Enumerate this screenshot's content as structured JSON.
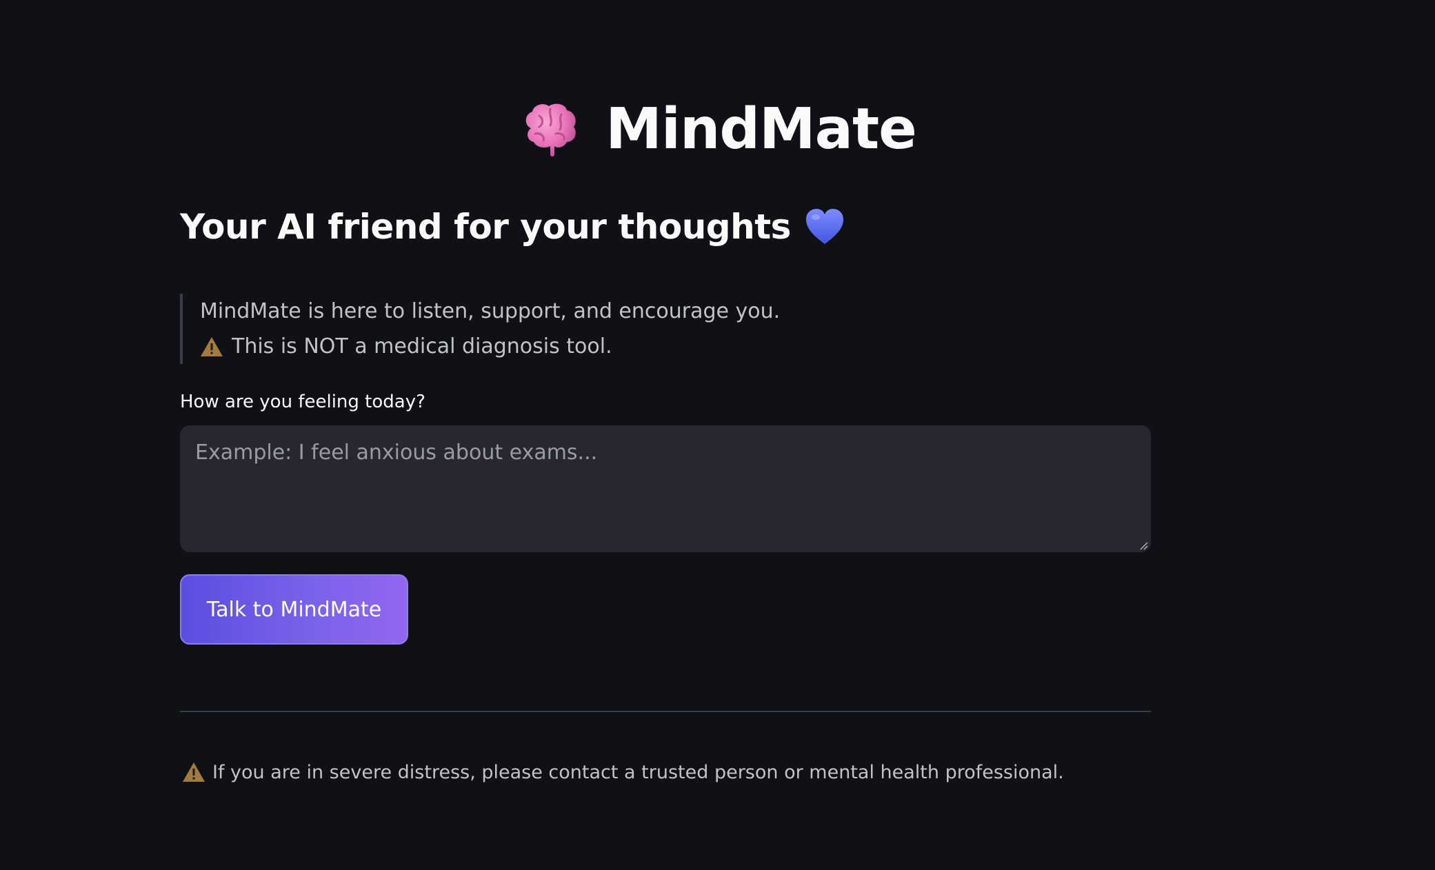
{
  "header": {
    "title": "MindMate",
    "title_icon": "brain-icon",
    "subtitle": "Your AI friend for your thoughts",
    "subtitle_icon": "blue-heart-icon"
  },
  "intro": {
    "line1": "MindMate is here to listen, support, and encourage you.",
    "line2": "This is NOT a medical diagnosis tool.",
    "line2_icon": "warning-icon"
  },
  "form": {
    "label": "How are you feeling today?",
    "placeholder": "Example: I feel anxious about exams...",
    "value": "",
    "button_label": "Talk to MindMate"
  },
  "footer": {
    "note": "If you are in severe distress, please contact a trusted person or mental health professional.",
    "note_icon": "warning-icon"
  },
  "colors": {
    "background": "#0f1117",
    "input_background": "#262730",
    "button_gradient_start": "#5b4ee0",
    "button_gradient_end": "#9366ef",
    "warning": "#a37b3c",
    "heart": "#5b6cf0",
    "brain": "#e872b8"
  }
}
